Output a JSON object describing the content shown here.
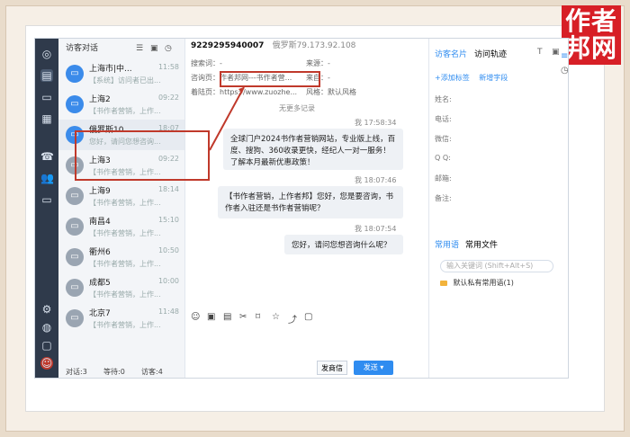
{
  "brand": {
    "line1": "作者",
    "line2": "邦网"
  },
  "app": {
    "left_title": "访客对话",
    "contacts": [
      {
        "name": "上海市|中...",
        "time": "11:58",
        "preview": "【系统】访问者已出...",
        "online": true
      },
      {
        "name": "上海2",
        "time": "09:22",
        "preview": "【书作者营销，上作...",
        "online": true
      },
      {
        "name": "俄罗斯10",
        "time": "18:07",
        "preview": "您好，请问您想咨询...",
        "online": true
      },
      {
        "name": "上海3",
        "time": "09:22",
        "preview": "【书作者营销，上作...",
        "online": false
      },
      {
        "name": "上海9",
        "time": "18:14",
        "preview": "【书作者营销，上作...",
        "online": false
      },
      {
        "name": "南昌4",
        "time": "15:10",
        "preview": "【书作者营销，上作...",
        "online": false
      },
      {
        "name": "衢州6",
        "time": "10:50",
        "preview": "【书作者营销，上作...",
        "online": false
      },
      {
        "name": "成都5",
        "time": "10:00",
        "preview": "【书作者营销，上作...",
        "online": false
      },
      {
        "name": "北京7",
        "time": "11:48",
        "preview": "【书作者营销，上作...",
        "online": false
      }
    ],
    "footer": {
      "a": "对话:3",
      "b": "等待:0",
      "c": "访客:4"
    }
  },
  "chat": {
    "id": "9229295940007",
    "subtitle": "俄罗斯79.173.92.108",
    "info": {
      "search_word": "搜索词：-",
      "source": "来源：-",
      "visited_page": "咨询页：作者邦网---书作者营...",
      "from": "来自：-",
      "landing": "着陆页：https://www.zuozhe...",
      "style": "风格：默认风格"
    },
    "load_more": "无更多记录",
    "messages": [
      {
        "stamp": "我 17:58:34",
        "text": "全球门户2024书作者营销网站，专业版上线，百度、搜狗、360收录更快，经纪人一对一服务！了解本月最新优惠政策！"
      },
      {
        "stamp": "我 18:07:46",
        "text": "【书作者营销，上作者邦】您好，您是要咨询，书作者入驻还是书作者营销呢？"
      },
      {
        "stamp": "我 18:07:54",
        "text": "您好，请问您想咨询什么呢？"
      }
    ],
    "send_secondary": "发商信",
    "send_primary": "发送"
  },
  "sidepanel": {
    "tab1": "访客名片",
    "tab2": "访问轨迹",
    "action1": "+添加标签",
    "action2": "新增字段",
    "fields": [
      "姓名:",
      "电话:",
      "微信:",
      "Q Q:",
      "邮箱:",
      "备注:"
    ],
    "quick_tab1": "常用语",
    "quick_tab2": "常用文件",
    "search_placeholder": "输入关键词 (Shift+Alt+S)",
    "folder": "默认私有常用语(1)"
  }
}
